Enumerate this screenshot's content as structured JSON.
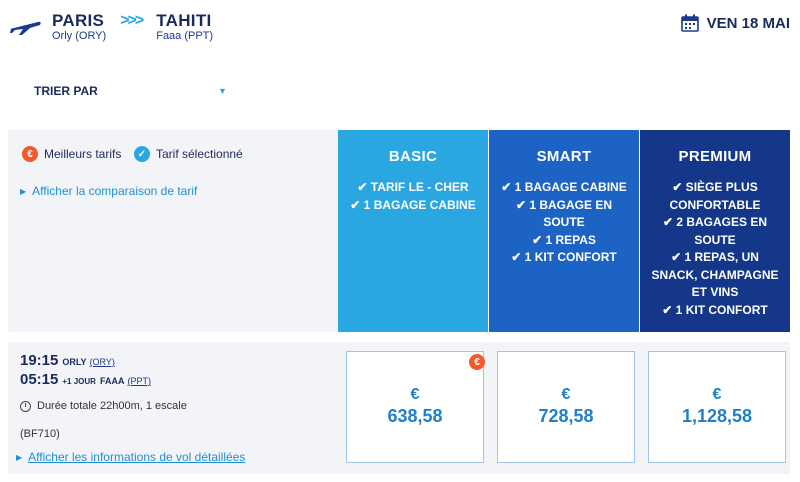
{
  "route": {
    "origin_city": "PARIS",
    "origin_airport": "Orly (ORY)",
    "separator": ">>>",
    "destination_city": "TAHITI",
    "destination_airport": "Faaa (PPT)"
  },
  "date_label": "VEN 18 MAI",
  "sort": {
    "label": "TRIER PAR",
    "caret": "▼"
  },
  "legend": {
    "best_icon": "€",
    "best_label": "Meilleurs tarifs",
    "selected_icon": "✓",
    "selected_label": "Tarif sélectionné",
    "compare_caret": "▶",
    "compare_link": "Afficher la comparaison de tarif"
  },
  "fares": [
    {
      "name": "BASIC",
      "features": [
        "✔ TARIF LE - CHER",
        "✔ 1 BAGAGE CABINE"
      ]
    },
    {
      "name": "SMART",
      "features": [
        "✔ 1 BAGAGE CABINE",
        "✔ 1 BAGAGE EN",
        "SOUTE",
        "✔ 1 REPAS",
        "✔ 1 KIT CONFORT"
      ]
    },
    {
      "name": "PREMIUM",
      "features": [
        "✔ SIÈGE PLUS",
        "CONFORTABLE",
        "✔ 2 BAGAGES EN",
        "SOUTE",
        "✔ 1 REPAS, UN",
        "SNACK, CHAMPAGNE",
        "ET VINS",
        "✔ 1 KIT CONFORT"
      ]
    }
  ],
  "flight": {
    "depart_time": "19:15",
    "depart_airport": "ORLY",
    "depart_code": "(ORY)",
    "arrive_time": "05:15",
    "plus_day": "+1 JOUR",
    "arrive_airport": "FAAA",
    "arrive_code": "(PPT)",
    "duration": "Durée totale 22h00m, 1 escale",
    "flight_number": "(BF710)",
    "details_caret": "▶",
    "details_link": "Afficher les informations de vol détaillées"
  },
  "prices": [
    {
      "currency": "€",
      "amount": "638,58",
      "best": true,
      "best_icon": "€"
    },
    {
      "currency": "€",
      "amount": "728,58",
      "best": false
    },
    {
      "currency": "€",
      "amount": "1,128,58",
      "best": false
    }
  ],
  "colors": {
    "basic": "#2aa6e0",
    "smart": "#1c63c4",
    "premium": "#14378a",
    "accent_orange": "#f25a2b",
    "navy_text": "#1b2a5c"
  },
  "icons": {
    "plane": "plane-icon",
    "calendar": "calendar-icon",
    "clock": "clock-icon"
  }
}
